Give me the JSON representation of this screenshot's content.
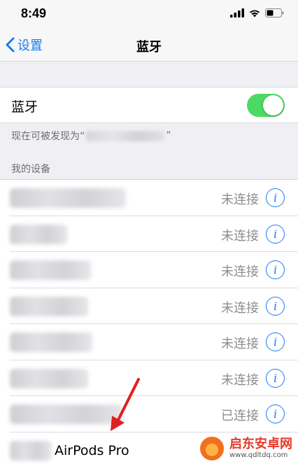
{
  "status_bar": {
    "time": "8:49"
  },
  "nav": {
    "back_label": "设置",
    "title": "蓝牙"
  },
  "bluetooth": {
    "label": "蓝牙",
    "enabled": true
  },
  "discoverable": {
    "prefix": "现在可被发现为“",
    "suffix": "”"
  },
  "my_devices": {
    "header": "我的设备",
    "devices": [
      {
        "status": "未连接"
      },
      {
        "status": "未连接"
      },
      {
        "status": "未连接"
      },
      {
        "status": "未连接"
      },
      {
        "status": "未连接"
      },
      {
        "status": "未连接"
      },
      {
        "status": "已连接"
      },
      {
        "name": "AirPods Pro"
      }
    ]
  },
  "watermark": {
    "title": "启东安卓网",
    "url": "www.qdltdq.com"
  },
  "colors": {
    "accent": "#1a7cf5",
    "toggle_on": "#4cd964",
    "arrow": "#e02020"
  }
}
